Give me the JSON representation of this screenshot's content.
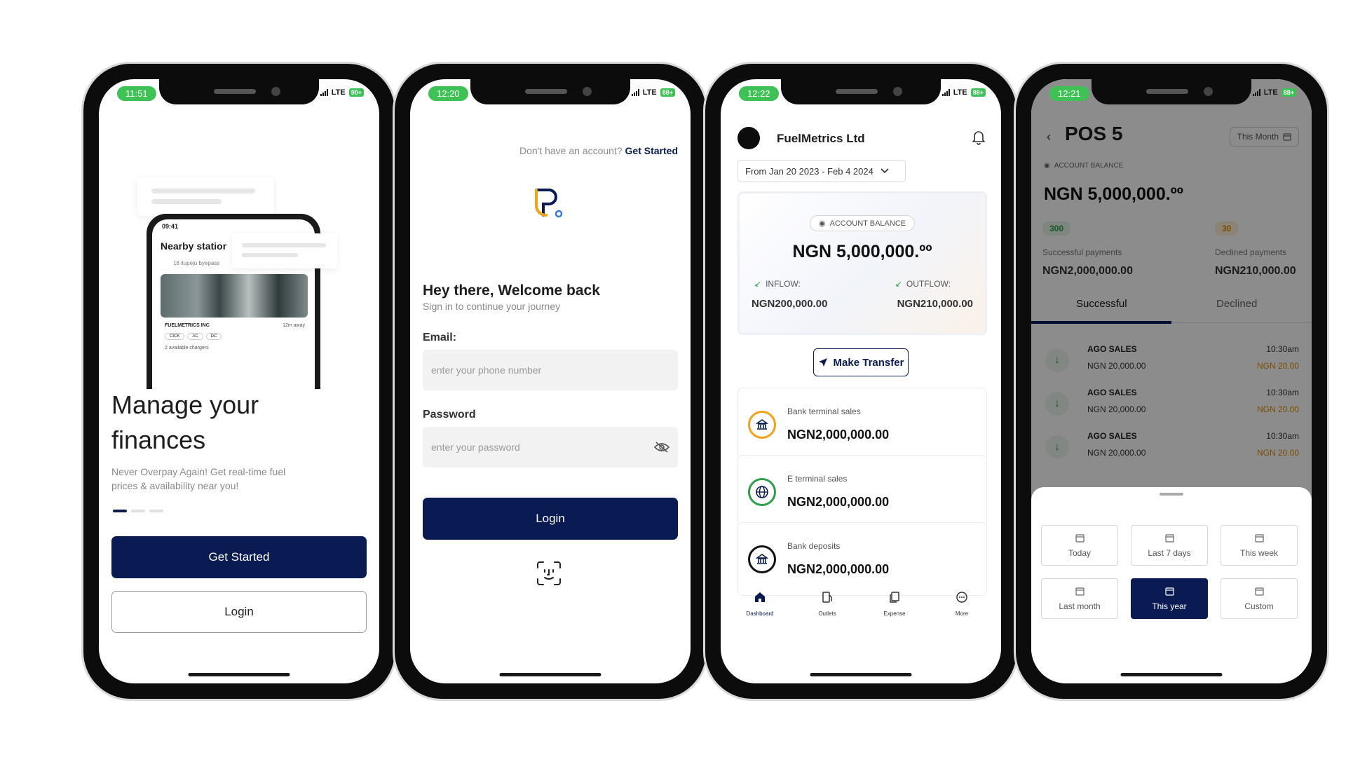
{
  "phone1": {
    "time": "11:51",
    "network": "LTE",
    "battery": "90+",
    "mockup": {
      "time": "09:41",
      "title": "Nearby statior",
      "address": "18 ilupeju byepass",
      "company": "FUELMETRICS INC",
      "distance": "12m away",
      "tags": [
        "CICK",
        "AC",
        "DC"
      ],
      "chargers": "2 available chargers"
    },
    "headline": "Manage your finances",
    "subtitle": "Never Overpay Again! Get real-time fuel prices & availability near you!",
    "get_started": "Get Started",
    "login": "Login"
  },
  "phone2": {
    "time": "12:20",
    "network": "LTE",
    "battery": "88+",
    "no_account": "Don't have an account?",
    "get_started_link": "Get Started",
    "welcome": "Hey there, Welcome back",
    "welcome_sub": "Sign in to continue your journey",
    "email_label": "Email:",
    "email_placeholder": "enter your phone number",
    "password_label": "Password",
    "password_placeholder": "enter your password",
    "login": "Login"
  },
  "phone3": {
    "time": "12:22",
    "network": "LTE",
    "battery": "88+",
    "company": "FuelMetrics Ltd",
    "range": "From Jan 20 2023 - Feb 4 2024",
    "account_balance_label": "ACCOUNT BALANCE",
    "balance": "NGN 5,000,000.ºº",
    "inflow_label": "INFLOW:",
    "inflow_value": "NGN200,000.00",
    "outflow_label": "OUTFLOW:",
    "outflow_value": "NGN210,000.00",
    "transfer": "Make Transfer",
    "sales": [
      {
        "label": "Bank terminal sales",
        "value": "NGN2,000,000.00"
      },
      {
        "label": "E terminal sales",
        "value": "NGN2,000,000.00"
      },
      {
        "label": "Bank deposits",
        "value": "NGN2,000,000.00"
      }
    ],
    "tabs": [
      "Dashboard",
      "Outlets",
      "Expense",
      "More"
    ]
  },
  "phone4": {
    "time": "12:21",
    "network": "LTE",
    "battery": "88+",
    "title": "POS 5",
    "period": "This Month",
    "account_balance_label": "ACCOUNT BALANCE",
    "balance": "NGN 5,000,000.ºº",
    "success_count": "300",
    "declined_count": "30",
    "success_label": "Successful payments",
    "declined_label": "Declined payments",
    "success_value": "NGN2,000,000.00",
    "declined_value": "NGN210,000.00",
    "tab_successful": "Successful",
    "tab_declined": "Declined",
    "transactions": [
      {
        "name": "AGO SALES",
        "amount": "NGN 20,000.00",
        "time": "10:30am",
        "fee": "NGN 20.00"
      },
      {
        "name": "AGO SALES",
        "amount": "NGN 20,000.00",
        "time": "10:30am",
        "fee": "NGN 20.00"
      },
      {
        "name": "AGO SALES",
        "amount": "NGN 20,000.00",
        "time": "10:30am",
        "fee": "NGN 20.00"
      }
    ],
    "filters": [
      "Today",
      "Last 7 days",
      "This week",
      "Last month",
      "This year",
      "Custom"
    ],
    "selected_filter": "This year"
  },
  "colors": {
    "primary": "#0a1a52",
    "status_green": "#3ec155",
    "accent_orange": "#e08a00"
  }
}
